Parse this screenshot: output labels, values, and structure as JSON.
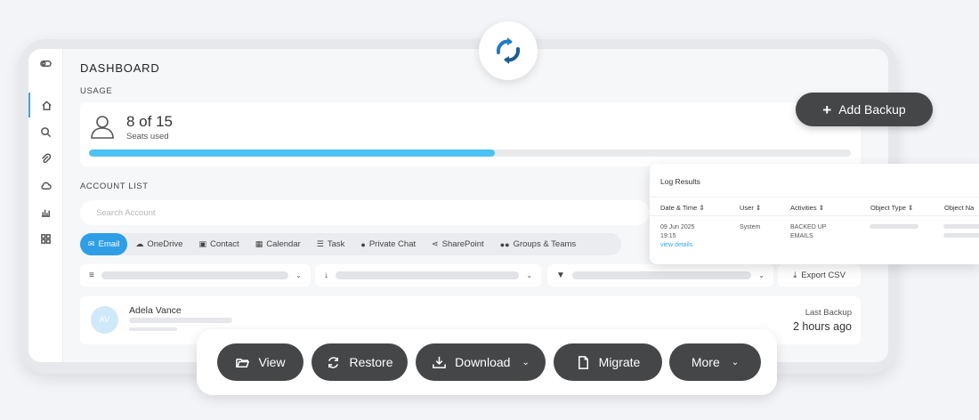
{
  "dashboard": {
    "title": "DASHBOARD",
    "usage_label": "USAGE",
    "seats_count": "8 of 15",
    "seats_label": "Seats used",
    "seats_fraction": 0.533,
    "account_list_label": "ACCOUNT LIST",
    "search_placeholder": "Search Account",
    "tabs": [
      {
        "label": "Email",
        "icon": "envelope-icon",
        "active": true
      },
      {
        "label": "OneDrive",
        "icon": "cloud-icon"
      },
      {
        "label": "Contact",
        "icon": "contact-card-icon"
      },
      {
        "label": "Calendar",
        "icon": "calendar-icon"
      },
      {
        "label": "Task",
        "icon": "list-icon"
      },
      {
        "label": "Private Chat",
        "icon": "chat-icon"
      },
      {
        "label": "SharePoint",
        "icon": "share-icon"
      },
      {
        "label": "Groups & Teams",
        "icon": "group-icon"
      }
    ],
    "export_label": "Export CSV",
    "account": {
      "initials": "AV",
      "name": "Adela Vance",
      "last_backup_label": "Last Backup",
      "last_backup_value": "2 hours ago"
    }
  },
  "add_backup_label": "Add Backup",
  "log": {
    "title": "Log Results",
    "columns": [
      "Date & Time",
      "User",
      "Activities",
      "Object Type",
      "Object Na"
    ],
    "row": {
      "date": "09 Jun 2025",
      "time": "19:15",
      "link": "view details",
      "user": "System",
      "activity_line1": "BACKED UP",
      "activity_line2": "EMAILS"
    }
  },
  "actions": [
    {
      "label": "View",
      "icon": "folder-open-icon"
    },
    {
      "label": "Restore",
      "icon": "refresh-icon"
    },
    {
      "label": "Download",
      "icon": "download-tray-icon",
      "dropdown": true
    },
    {
      "label": "Migrate",
      "icon": "file-icon"
    },
    {
      "label": "More",
      "dropdown": true
    }
  ],
  "colors": {
    "accent": "#2e9ee6",
    "progress": "#4cc3f4",
    "dark_button": "#454648"
  }
}
